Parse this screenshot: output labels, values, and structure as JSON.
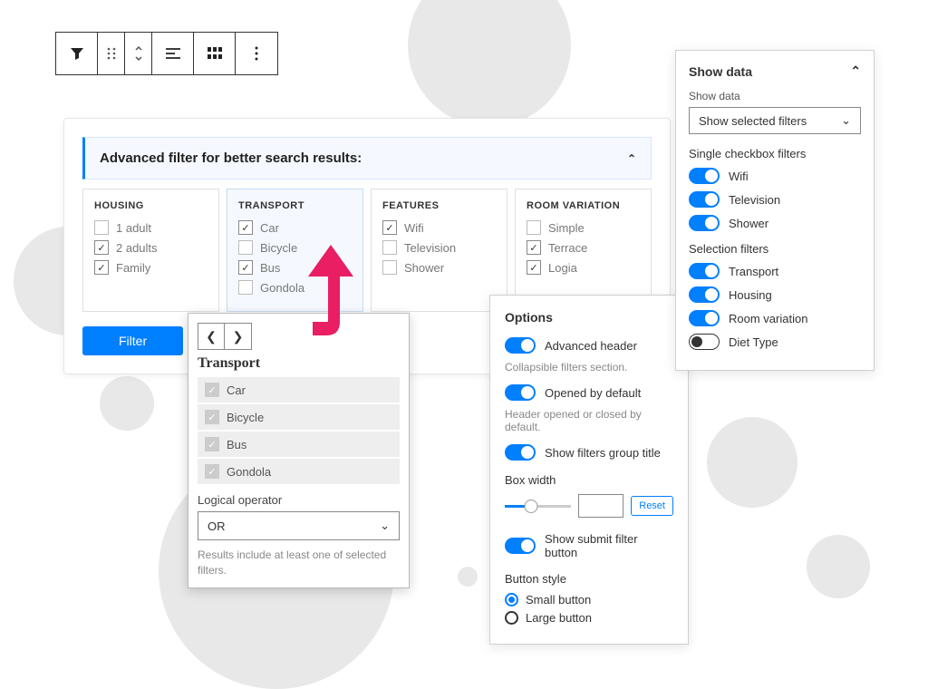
{
  "filter": {
    "header": "Advanced filter for better search results:",
    "button": "Filter",
    "groups": [
      {
        "title": "HOUSING",
        "items": [
          "1 adult",
          "2 adults",
          "Family"
        ],
        "checked": [
          false,
          true,
          true
        ]
      },
      {
        "title": "TRANSPORT",
        "items": [
          "Car",
          "Bicycle",
          "Bus",
          "Gondola"
        ],
        "checked": [
          true,
          false,
          true,
          false
        ],
        "active": true
      },
      {
        "title": "FEATURES",
        "items": [
          "Wifi",
          "Television",
          "Shower"
        ],
        "checked": [
          true,
          false,
          false
        ]
      },
      {
        "title": "ROOM VARIATION",
        "items": [
          "Simple",
          "Terrace",
          "Logia"
        ],
        "checked": [
          false,
          true,
          true
        ]
      }
    ]
  },
  "transportPopup": {
    "title": "Transport",
    "items": [
      "Car",
      "Bicycle",
      "Bus",
      "Gondola"
    ],
    "logicalOperatorLabel": "Logical operator",
    "logicalOperatorValue": "OR",
    "helper": "Results include at least one of selected filters."
  },
  "options": {
    "title": "Options",
    "advancedHeader": {
      "label": "Advanced header",
      "helper": "Collapsible filters section."
    },
    "openedDefault": {
      "label": "Opened by default",
      "helper": "Header opened or closed by default."
    },
    "showGroupTitle": {
      "label": "Show filters group title"
    },
    "boxWidth": {
      "label": "Box width",
      "reset": "Reset"
    },
    "showSubmit": {
      "label": "Show submit filter button"
    },
    "buttonStyle": {
      "label": "Button style",
      "options": [
        "Small button",
        "Large button"
      ]
    }
  },
  "showData": {
    "title": "Show data",
    "subLabel": "Show data",
    "selectValue": "Show selected filters",
    "singleCheckboxLabel": "Single checkbox filters",
    "singleCheckbox": [
      "Wifi",
      "Television",
      "Shower"
    ],
    "selectionFiltersLabel": "Selection filters",
    "selectionFilters": [
      {
        "label": "Transport",
        "on": true
      },
      {
        "label": "Housing",
        "on": true
      },
      {
        "label": "Room variation",
        "on": true
      },
      {
        "label": "Diet Type",
        "on": false
      }
    ]
  }
}
